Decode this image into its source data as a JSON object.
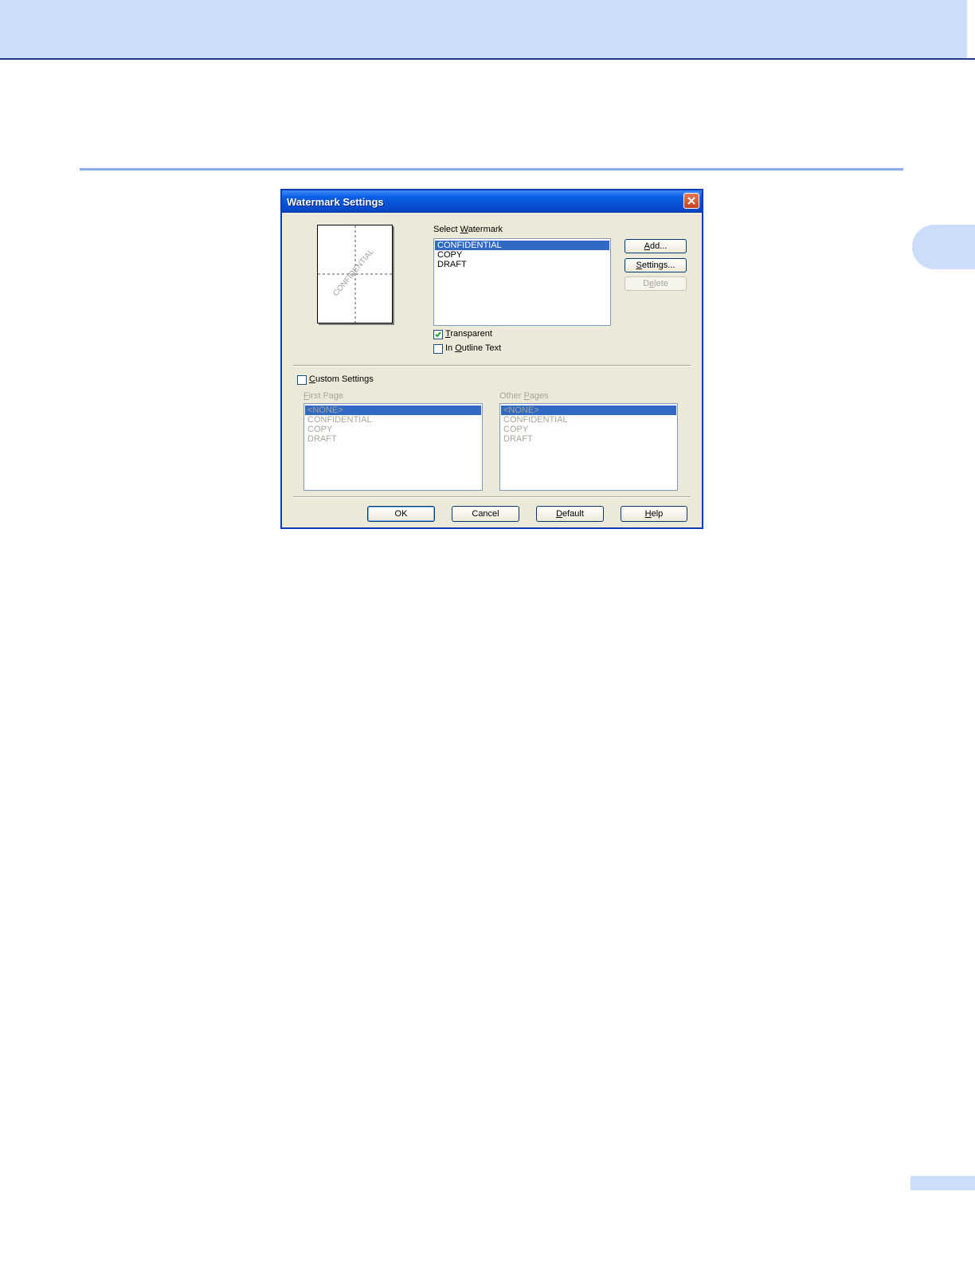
{
  "dialog": {
    "title": "Watermark Settings",
    "preview_watermark": "CONFIDENTIAL",
    "select_watermark_label": "Select Watermark",
    "watermarks": [
      "CONFIDENTIAL",
      "COPY",
      "DRAFT"
    ],
    "selected_index": 0,
    "buttons": {
      "add": "Add...",
      "settings": "Settings...",
      "delete": "Delete"
    },
    "transparent": {
      "label": "Transparent",
      "checked": true
    },
    "outline": {
      "label": "In Outline Text",
      "checked": false
    },
    "custom_settings": {
      "label": "Custom Settings",
      "checked": false
    },
    "first_page": {
      "label": "First Page",
      "items": [
        "<NONE>",
        "CONFIDENTIAL",
        "COPY",
        "DRAFT"
      ]
    },
    "other_pages": {
      "label": "Other Pages",
      "items": [
        "<NONE>",
        "CONFIDENTIAL",
        "COPY",
        "DRAFT"
      ]
    },
    "footer": {
      "ok": "OK",
      "cancel": "Cancel",
      "default": "Default",
      "help": "Help"
    }
  }
}
